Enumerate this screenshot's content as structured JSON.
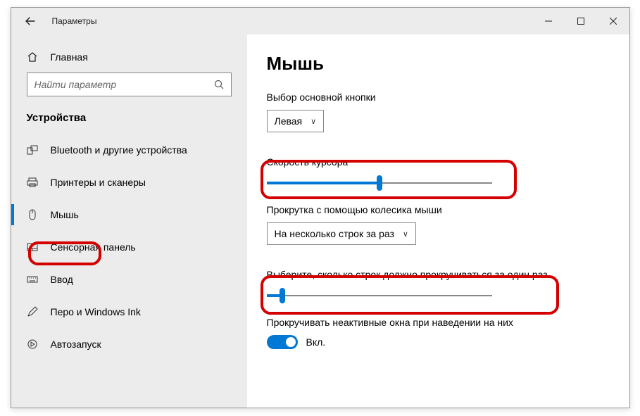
{
  "window": {
    "title": "Параметры"
  },
  "sidebar": {
    "home_label": "Главная",
    "search_placeholder": "Найти параметр",
    "category_label": "Устройства",
    "items": [
      {
        "label": "Bluetooth и другие устройства"
      },
      {
        "label": "Принтеры и сканеры"
      },
      {
        "label": "Мышь"
      },
      {
        "label": "Сенсорная панель"
      },
      {
        "label": "Ввод"
      },
      {
        "label": "Перо и Windows Ink"
      },
      {
        "label": "Автозапуск"
      }
    ]
  },
  "main": {
    "title": "Мышь",
    "primary_button": {
      "label": "Выбор основной кнопки",
      "value": "Левая"
    },
    "cursor_speed": {
      "label": "Скорость курсора",
      "percent": 50
    },
    "scroll_mode": {
      "label": "Прокрутка с помощью колесика мыши",
      "value": "На несколько строк за раз"
    },
    "lines_per_scroll": {
      "label": "Выберите, сколько строк должно прокручиваться за один раз",
      "percent": 7
    },
    "scroll_inactive": {
      "label": "Прокручивать неактивные окна при наведении на них",
      "state": "Вкл."
    }
  }
}
